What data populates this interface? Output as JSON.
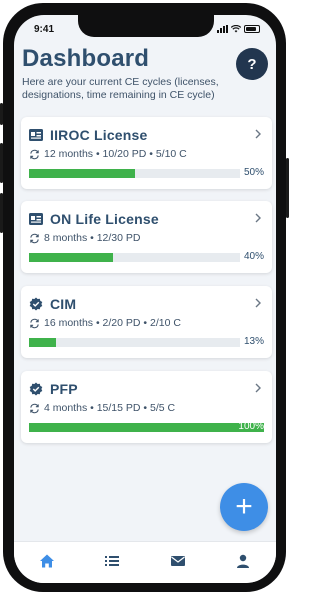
{
  "status_bar": {
    "time": "9:41",
    "icons": [
      "signal-icon",
      "wifi-icon",
      "battery-icon"
    ]
  },
  "header": {
    "title": "Dashboard",
    "subtitle": "Here are your current CE cycles (licenses, designations, time remaining in CE cycle)",
    "help_label": "?"
  },
  "cards": [
    {
      "name": "IIROC License",
      "icon": "license-icon",
      "meta": "12 months • 10/20 PD • 5/10 C",
      "progress": 50,
      "progress_label": "50%"
    },
    {
      "name": "ON Life License",
      "icon": "license-icon",
      "meta": "8 months • 12/30 PD",
      "progress": 40,
      "progress_label": "40%"
    },
    {
      "name": "CIM",
      "icon": "verified-badge-icon",
      "meta": "16 months • 2/20 PD • 2/10 C",
      "progress": 13,
      "progress_label": "13%"
    },
    {
      "name": "PFP",
      "icon": "verified-badge-icon",
      "meta": "4 months • 15/15 PD • 5/5 C",
      "progress": 100,
      "progress_label": "100%"
    }
  ],
  "fab": {
    "label": "+"
  },
  "tab_bar": {
    "tabs": [
      "home-icon",
      "list-icon",
      "mail-icon",
      "profile-icon"
    ],
    "active": "home-icon"
  },
  "colors": {
    "accent": "#3e8ee6",
    "progress": "#3fb24b",
    "title": "#2f4f6e",
    "help_button": "#22364f"
  }
}
